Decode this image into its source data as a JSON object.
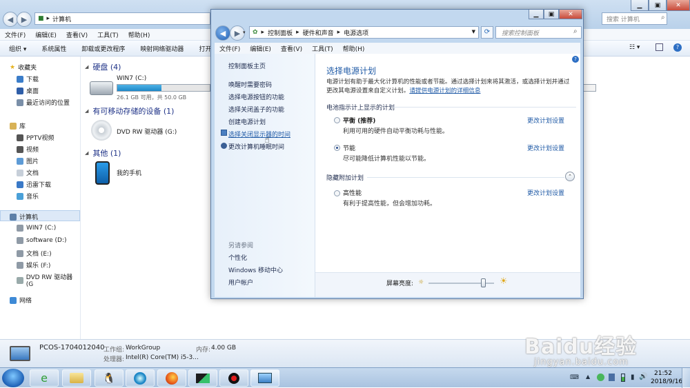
{
  "explorer": {
    "address": "计算机",
    "search_placeholder": "搜索 计算机",
    "menu": [
      "文件(F)",
      "编辑(E)",
      "查看(V)",
      "工具(T)",
      "帮助(H)"
    ],
    "toolbar": [
      "组织 ▾",
      "系统属性",
      "卸载或更改程序",
      "映射网络驱动器",
      "打开"
    ],
    "sidebar": {
      "favorites": "收藏夹",
      "favorites_items": [
        "下载",
        "桌面",
        "最近访问的位置"
      ],
      "libraries": "库",
      "library_items": [
        "PPTV视频",
        "视频",
        "图片",
        "文档",
        "迅雷下载",
        "音乐"
      ],
      "computer": "计算机",
      "computer_items": [
        "WIN7 (C:)",
        "software (D:)",
        "文档 (E:)",
        "娱乐 (F:)",
        "DVD RW 驱动器 (G"
      ],
      "network": "网络"
    },
    "sections": {
      "hdd": "硬盘 (4)",
      "removable": "有可移动存储的设备 (1)",
      "other": "其他 (1)"
    },
    "drive_c": {
      "name": "WIN7 (C:)",
      "info": "26.1 GB 可用，共 50.0 GB",
      "used_fraction": 0.48
    },
    "dvd": "DVD RW 驱动器 (G:)",
    "phone": "我的手机",
    "status": {
      "pc_name": "PCOS-1704012040",
      "workgroup_label": "工作组:",
      "workgroup": "WorkGroup",
      "memory_label": "内存:",
      "memory": "4.00 GB",
      "cpu_label": "处理器:",
      "cpu": "Intel(R) Core(TM) i5-3..."
    }
  },
  "control_panel": {
    "breadcrumb": [
      "控制面板",
      "硬件和声音",
      "电源选项"
    ],
    "search_placeholder": "搜索控制面板",
    "menu": [
      "文件(F)",
      "编辑(E)",
      "查看(V)",
      "工具(T)",
      "帮助(H)"
    ],
    "left_links": [
      "控制面板主页",
      "唤醒时需要密码",
      "选择电源按钮的功能",
      "选择关闭盖子的功能",
      "创建电源计划",
      "选择关闭显示器的时间",
      "更改计算机睡眠时间"
    ],
    "see_also_title": "另请参阅",
    "see_also": [
      "个性化",
      "Windows 移动中心",
      "用户帐户"
    ],
    "title": "选择电源计划",
    "description": "电源计划有助于最大化计算机的性能或者节能。通过选择计划来将其激活，或选择计划并通过更改其电源设置来自定义计划。",
    "more_link": "请提供电源计划的详细信息",
    "battery_group": "电池指示计上显示的计划",
    "plans": [
      {
        "name": "平衡 (推荐)",
        "desc": "利用可用的硬件自动平衡功耗与性能。",
        "selected": false
      },
      {
        "name": "节能",
        "desc": "尽可能降低计算机性能以节能。",
        "selected": true
      }
    ],
    "hidden_group": "隐藏附加计划",
    "hidden_plans": [
      {
        "name": "高性能",
        "desc": "有利于提高性能，但会增加功耗。",
        "selected": false
      }
    ],
    "change_label": "更改计划设置",
    "brightness_label": "屏幕亮度:",
    "brightness_level": 0.83
  },
  "taskbar": {
    "time": "21:52",
    "date": "2018/9/16"
  },
  "watermark": {
    "brand": "Baidu经验",
    "url": "jingyan.baidu.com"
  }
}
